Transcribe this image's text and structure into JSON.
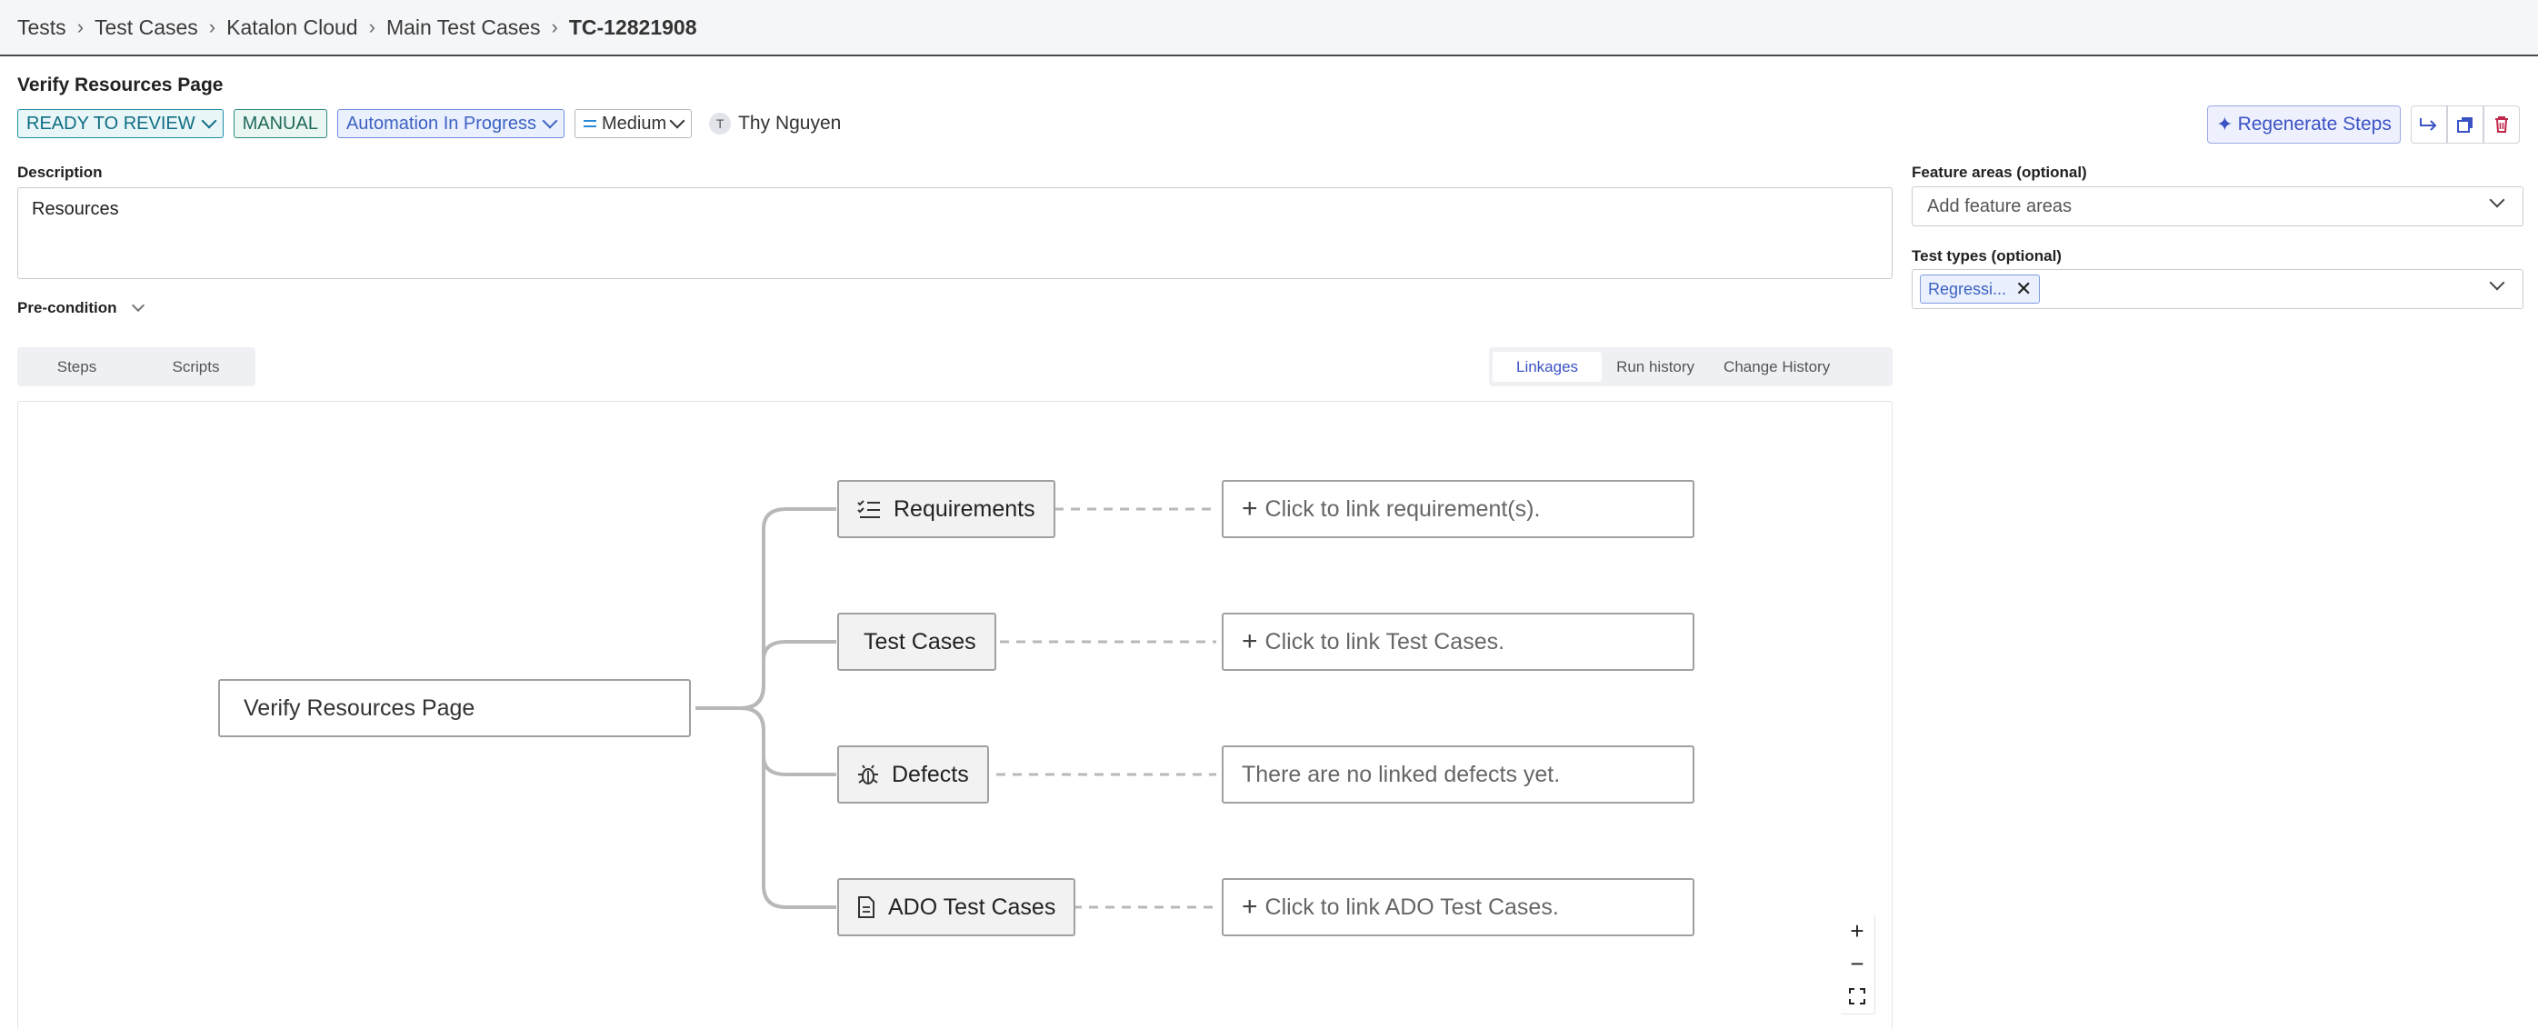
{
  "breadcrumb": {
    "items": [
      "Tests",
      "Test Cases",
      "Katalon Cloud",
      "Main Test Cases"
    ],
    "current": "TC-12821908"
  },
  "page": {
    "title": "Verify Resources Page"
  },
  "status": {
    "review": "READY TO REVIEW",
    "type": "MANUAL",
    "automation": "Automation In Progress",
    "priority": "Medium",
    "assignee_initial": "T",
    "assignee_name": "Thy Nguyen"
  },
  "toolbar": {
    "regenerate_label": "Regenerate Steps",
    "icons": [
      "share-icon",
      "duplicate-icon",
      "delete-icon"
    ]
  },
  "description": {
    "label": "Description",
    "value": "Resources"
  },
  "precondition": {
    "label": "Pre-condition"
  },
  "feature_areas": {
    "label": "Feature areas (optional)",
    "placeholder": "Add feature areas"
  },
  "test_types": {
    "label": "Test types (optional)",
    "tag": "Regressi..."
  },
  "tabs_left": [
    "Steps",
    "Scripts"
  ],
  "tabs_right": [
    "Linkages",
    "Run history",
    "Change History"
  ],
  "linkages": {
    "root": "Verify Resources Page",
    "categories": [
      {
        "label": "Requirements",
        "icon": "checklist-icon",
        "link_text": "Click to link requirement(s).",
        "has_plus": true
      },
      {
        "label": "Test Cases",
        "icon": "",
        "link_text": "Click to link Test Cases.",
        "has_plus": true
      },
      {
        "label": "Defects",
        "icon": "bug-icon",
        "link_text": "There are no linked defects yet.",
        "has_plus": false
      },
      {
        "label": "ADO Test Cases",
        "icon": "document-icon",
        "link_text": "Click to link ADO Test Cases.",
        "has_plus": true
      }
    ]
  },
  "zoom": {
    "in": "+",
    "out": "−"
  },
  "colors": {
    "accent": "#3b52c4",
    "review": "#0f6d84",
    "manual": "#1f6a5c",
    "danger": "#c0284b"
  }
}
